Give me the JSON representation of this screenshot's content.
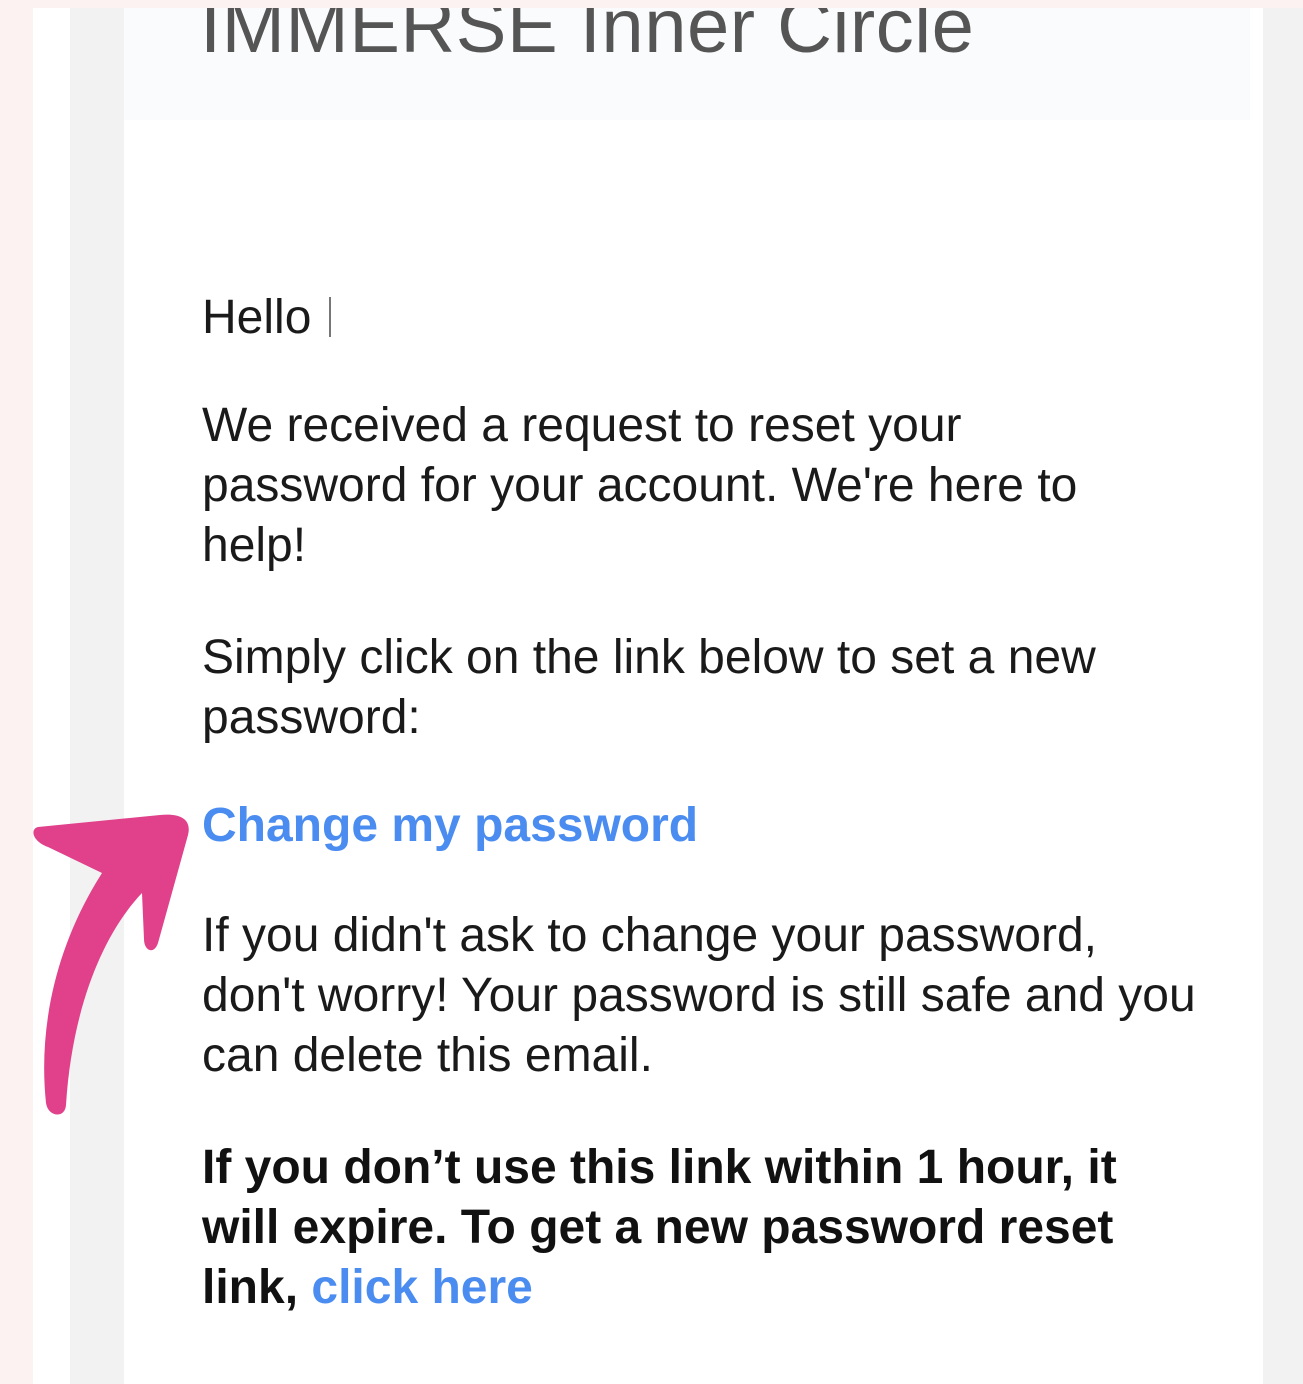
{
  "header": {
    "title": "IMMERSE Inner Circle"
  },
  "email": {
    "greeting": "Hello",
    "paragraph_1": "We received a request to reset your password for your account. We're here to help!",
    "paragraph_2": "Simply click on the link below to set a new password:",
    "reset_link_label": "Change my password",
    "paragraph_3": "If you didn't ask to change your password, don't worry! Your password is still safe and you can delete this email.",
    "expiry_notice": "If you don’t use this link within 1 hour, it will expire. To get a new password reset link,",
    "click_here_label": "click here"
  },
  "colors": {
    "link": "#4a8cf0",
    "arrow": "#e0418a",
    "page_background": "#fdf2f2"
  },
  "icons": {
    "annotation_arrow": "curved-arrow-icon"
  }
}
